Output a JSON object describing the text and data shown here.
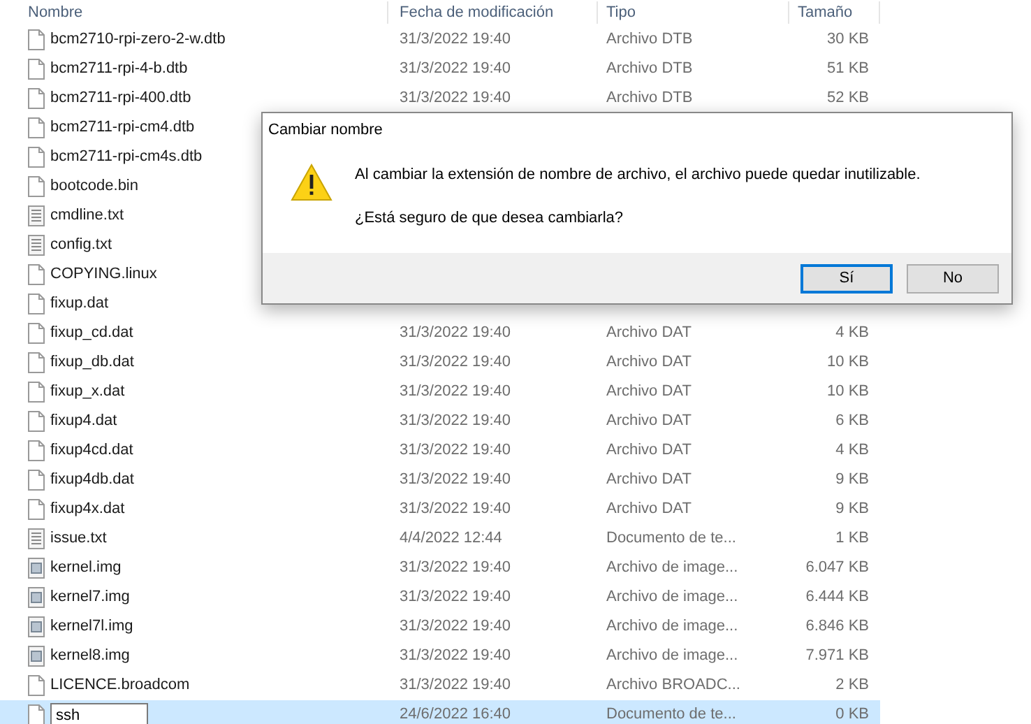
{
  "columns": [
    "Nombre",
    "Fecha de modificación",
    "Tipo",
    "Tamaño"
  ],
  "files": [
    {
      "name": "bcm2710-rpi-zero-2-w.dtb",
      "kind": "file",
      "date": "31/3/2022 19:40",
      "type": "Archivo DTB",
      "size": "30 KB",
      "selected": false
    },
    {
      "name": "bcm2711-rpi-4-b.dtb",
      "kind": "file",
      "date": "31/3/2022 19:40",
      "type": "Archivo DTB",
      "size": "51 KB",
      "selected": false
    },
    {
      "name": "bcm2711-rpi-400.dtb",
      "kind": "file",
      "date": "31/3/2022 19:40",
      "type": "Archivo DTB",
      "size": "52 KB",
      "selected": false
    },
    {
      "name": "bcm2711-rpi-cm4.dtb",
      "kind": "file",
      "selected": false
    },
    {
      "name": "bcm2711-rpi-cm4s.dtb",
      "kind": "file",
      "selected": false
    },
    {
      "name": "bootcode.bin",
      "kind": "file",
      "selected": false
    },
    {
      "name": "cmdline.txt",
      "kind": "text",
      "selected": false
    },
    {
      "name": "config.txt",
      "kind": "text",
      "selected": false
    },
    {
      "name": "COPYING.linux",
      "kind": "file",
      "selected": false
    },
    {
      "name": "fixup.dat",
      "kind": "file",
      "selected": false
    },
    {
      "name": "fixup_cd.dat",
      "kind": "file",
      "date": "31/3/2022 19:40",
      "type": "Archivo DAT",
      "size": "4 KB",
      "selected": false
    },
    {
      "name": "fixup_db.dat",
      "kind": "file",
      "date": "31/3/2022 19:40",
      "type": "Archivo DAT",
      "size": "10 KB",
      "selected": false
    },
    {
      "name": "fixup_x.dat",
      "kind": "file",
      "date": "31/3/2022 19:40",
      "type": "Archivo DAT",
      "size": "10 KB",
      "selected": false
    },
    {
      "name": "fixup4.dat",
      "kind": "file",
      "date": "31/3/2022 19:40",
      "type": "Archivo DAT",
      "size": "6 KB",
      "selected": false
    },
    {
      "name": "fixup4cd.dat",
      "kind": "file",
      "date": "31/3/2022 19:40",
      "type": "Archivo DAT",
      "size": "4 KB",
      "selected": false
    },
    {
      "name": "fixup4db.dat",
      "kind": "file",
      "date": "31/3/2022 19:40",
      "type": "Archivo DAT",
      "size": "9 KB",
      "selected": false
    },
    {
      "name": "fixup4x.dat",
      "kind": "file",
      "date": "31/3/2022 19:40",
      "type": "Archivo DAT",
      "size": "9 KB",
      "selected": false
    },
    {
      "name": "issue.txt",
      "kind": "text",
      "date": "4/4/2022 12:44",
      "type": "Documento de te...",
      "size": "1 KB",
      "selected": false
    },
    {
      "name": "kernel.img",
      "kind": "image",
      "date": "31/3/2022 19:40",
      "type": "Archivo de image...",
      "size": "6.047 KB",
      "selected": false
    },
    {
      "name": "kernel7.img",
      "kind": "image",
      "date": "31/3/2022 19:40",
      "type": "Archivo de image...",
      "size": "6.444 KB",
      "selected": false
    },
    {
      "name": "kernel7l.img",
      "kind": "image",
      "date": "31/3/2022 19:40",
      "type": "Archivo de image...",
      "size": "6.846 KB",
      "selected": false
    },
    {
      "name": "kernel8.img",
      "kind": "image",
      "date": "31/3/2022 19:40",
      "type": "Archivo de image...",
      "size": "7.971 KB",
      "selected": false
    },
    {
      "name": "LICENCE.broadcom",
      "kind": "file",
      "date": "31/3/2022 19:40",
      "type": "Archivo BROADC...",
      "size": "2 KB",
      "selected": false
    },
    {
      "name": "ssh",
      "kind": "file",
      "editing": true,
      "date": "24/6/2022 16:40",
      "type": "Documento de te...",
      "size": "0 KB",
      "selected": true
    }
  ],
  "dialog": {
    "title": "Cambiar nombre",
    "message": "Al cambiar la extensión de nombre de archivo, el archivo puede quedar inutilizable.",
    "question": "¿Está seguro de que desea cambiarla?",
    "buttons": [
      {
        "label": "Sí",
        "selected": true
      },
      {
        "label": "No",
        "selected": false
      }
    ]
  }
}
